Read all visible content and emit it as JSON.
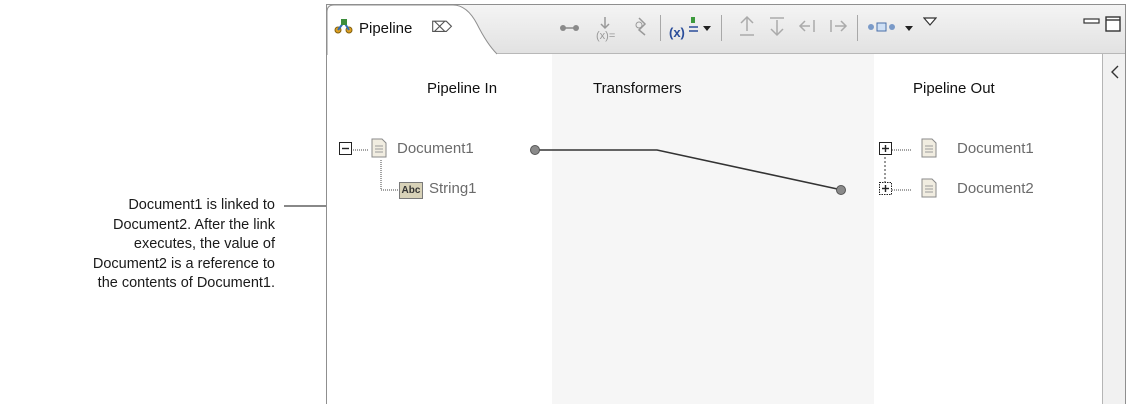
{
  "callout": {
    "lines": [
      "Document1 is linked to",
      "Document2. After the link",
      "executes, the value of",
      "Document2 is a reference to",
      "the contents of Document1."
    ]
  },
  "tab": {
    "label": "Pipeline",
    "close_glyph": "⌦"
  },
  "columns": {
    "pipeline_in": "Pipeline In",
    "transformers": "Transformers",
    "pipeline_out": "Pipeline Out"
  },
  "pipeline_in": {
    "document": "Document1",
    "string": "String1",
    "string_type_badge": "Abc"
  },
  "pipeline_out": {
    "items": [
      "Document1",
      "Document2"
    ]
  },
  "toolbar": {
    "icons": [
      "link-icon",
      "map-transformer-icon",
      "branch-icon",
      "variable-value-icon",
      "dropdown-arrow-icon",
      "shift-up-icon",
      "shift-down-icon",
      "shift-left-icon",
      "shift-right-icon",
      "layout-icon",
      "dropdown-arrow-icon",
      "view-menu-icon",
      "minimize-icon",
      "maximize-icon"
    ]
  },
  "colors": {
    "tab_bar": "#e6e6e6",
    "transformers_bg": "#f6f6f6",
    "link_line": "#333333",
    "disabled_text": "#6b6b6b"
  }
}
